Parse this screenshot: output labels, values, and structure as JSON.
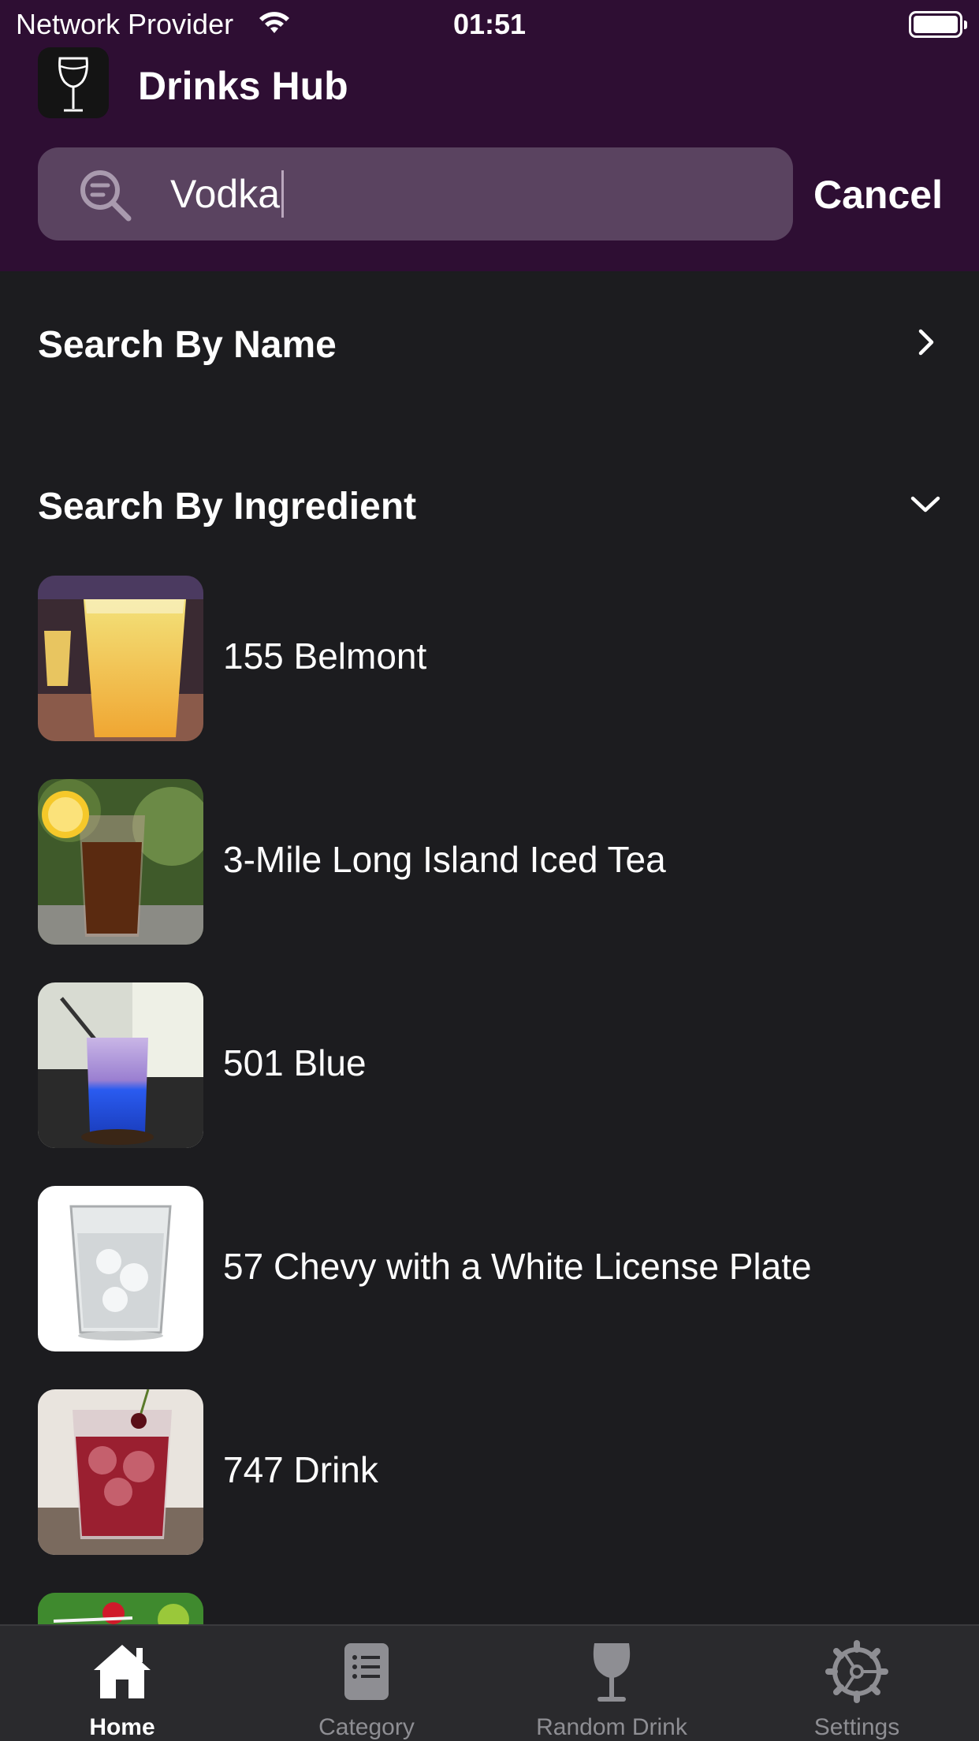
{
  "status_bar": {
    "carrier": "Network Provider",
    "time": "01:51"
  },
  "header": {
    "app_title": "Drinks Hub",
    "logo_icon": "wine-glass-icon"
  },
  "search": {
    "value": "Vodka",
    "cancel_label": "Cancel"
  },
  "sections": {
    "by_name": "Search By Name",
    "by_ingredient": "Search By Ingredient"
  },
  "drinks": [
    {
      "name": "155 Belmont"
    },
    {
      "name": "3-Mile Long Island Iced Tea"
    },
    {
      "name": "501 Blue"
    },
    {
      "name": "57 Chevy with a White License Plate"
    },
    {
      "name": "747 Drink"
    }
  ],
  "tabs": [
    {
      "label": "Home",
      "icon": "house-icon",
      "active": true
    },
    {
      "label": "Category",
      "icon": "list-icon",
      "active": false
    },
    {
      "label": "Random Drink",
      "icon": "wine-glass-icon",
      "active": false
    },
    {
      "label": "Settings",
      "icon": "gear-icon",
      "active": false
    }
  ],
  "colors": {
    "header_bg": "#2e0e33",
    "search_bg": "#5a4360",
    "body_bg": "#1c1c1f",
    "tab_bar_bg": "#2a2a2d"
  }
}
